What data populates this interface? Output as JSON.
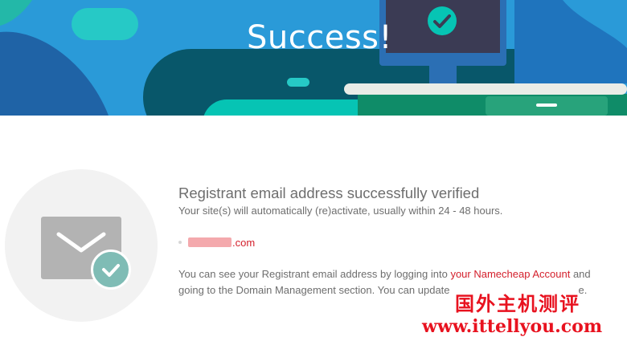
{
  "hero": {
    "title": "Success!",
    "colors": {
      "sky": "#2a9ad8",
      "dark_blue": "#1f63a6",
      "teal": "#06c4b4",
      "dark_teal": "#08576a",
      "green": "#0f8c68",
      "monitor": "#3b3b54"
    }
  },
  "main": {
    "heading": "Registrant email address successfully verified",
    "subtext": "Your site(s) will automatically (re)activate, usually within 24 - 48 hours.",
    "domain_suffix": ".com",
    "info_before_link": "You can see your Registrant email address by logging into ",
    "account_link": "your Namecheap Account",
    "info_after_link": " and going to the Domain Management section. You can update",
    "info_tail": "e."
  },
  "watermark": {
    "title": "国外主机测评",
    "url": "www.ittellyou.com"
  },
  "colors": {
    "text": "#6e6e6e",
    "accent": "#d4202c",
    "check_badge": "#7fbcb5",
    "envelope": "#b3b3b3"
  }
}
